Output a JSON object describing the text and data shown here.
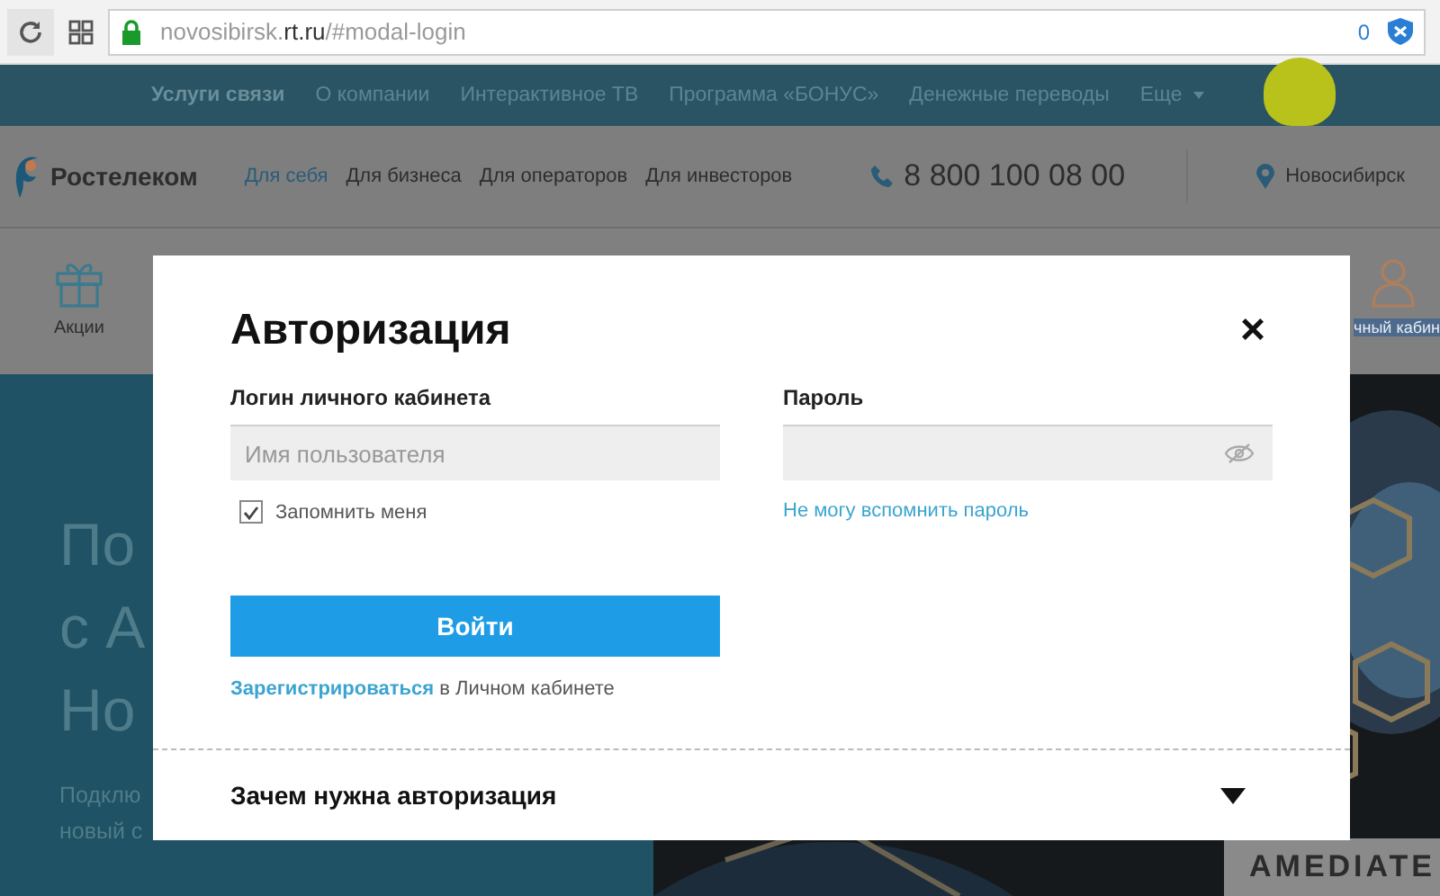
{
  "browser": {
    "url_host": "novosibirsk.",
    "url_domain": "rt.ru",
    "url_path": "/#modal-login",
    "badge": "0"
  },
  "top_nav": {
    "items": [
      {
        "label": "Услуги связи",
        "selected": true
      },
      {
        "label": "О компании",
        "selected": false
      },
      {
        "label": "Интерактивное ТВ",
        "selected": false
      },
      {
        "label": "Программа «БОНУС»",
        "selected": false
      },
      {
        "label": "Денежные переводы",
        "selected": false
      },
      {
        "label": "Еще",
        "selected": false
      }
    ]
  },
  "header": {
    "brand": "Ростелеком",
    "segments": [
      {
        "label": "Для себя",
        "selected": true
      },
      {
        "label": "Для бизнеса",
        "selected": false
      },
      {
        "label": "Для операторов",
        "selected": false
      },
      {
        "label": "Для инвесторов",
        "selected": false
      }
    ],
    "phone": "8 800 100 08 00",
    "city": "Новосибирск"
  },
  "quick_links": [
    {
      "kind": "gift",
      "label": "Акции"
    },
    {
      "kind": "account",
      "label": "чный кабин"
    }
  ],
  "hero": {
    "title_lines": [
      "По",
      "с А",
      "Но"
    ],
    "subtitle_lines": [
      "Подклю",
      "новый с"
    ],
    "banner_text": "AMEDIATE"
  },
  "modal": {
    "title": "Авторизация",
    "close": "×",
    "login": {
      "label": "Логин личного кабинета",
      "placeholder": "Имя пользователя"
    },
    "remember": {
      "label": "Запомнить меня",
      "checked": true
    },
    "password": {
      "label": "Пароль"
    },
    "forgot_link": "Не могу вспомнить пароль",
    "submit": "Войти",
    "register": {
      "link": "Зарегистрироваться",
      "text": "в Личном кабинете"
    },
    "faq": {
      "title": "Зачем нужна авторизация",
      "expanded": false
    }
  }
}
